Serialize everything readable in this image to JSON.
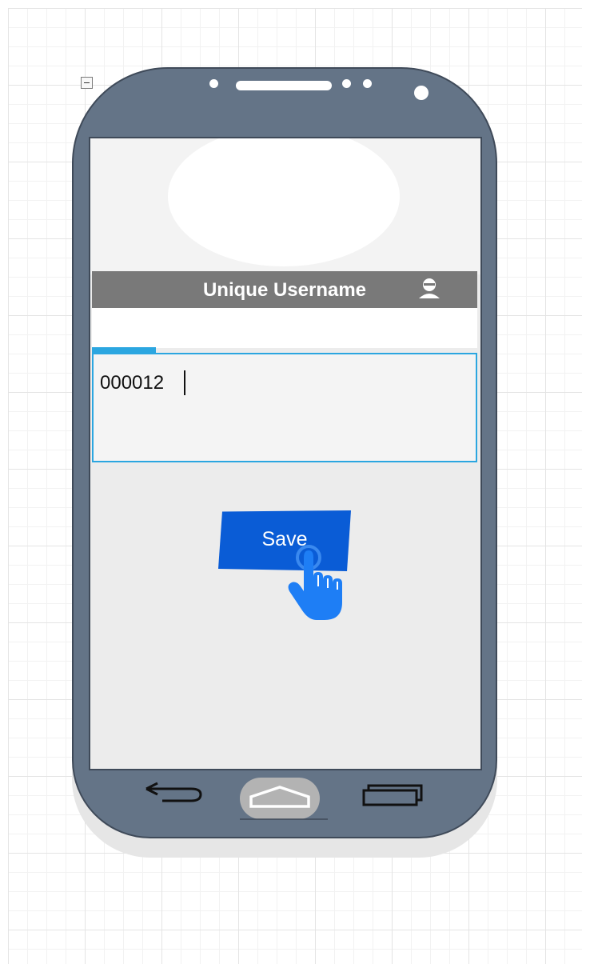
{
  "app": {
    "screen_title": "Unique Username"
  },
  "form": {
    "field_value": "000012",
    "save_label": "Save"
  },
  "icons": {
    "header": "user-icon",
    "pointer": "hand-pointer-icon",
    "nav_back": "back-arrow-icon",
    "nav_home": "home-icon",
    "nav_recent": "recent-apps-icon",
    "collapse": "collapse-icon"
  },
  "colors": {
    "phone_body": "#647487",
    "header_bar": "#797979",
    "focus_accent": "#2ba6e0",
    "save_button": "#0a5cd6",
    "hand_pointer": "#1e7ef5"
  }
}
